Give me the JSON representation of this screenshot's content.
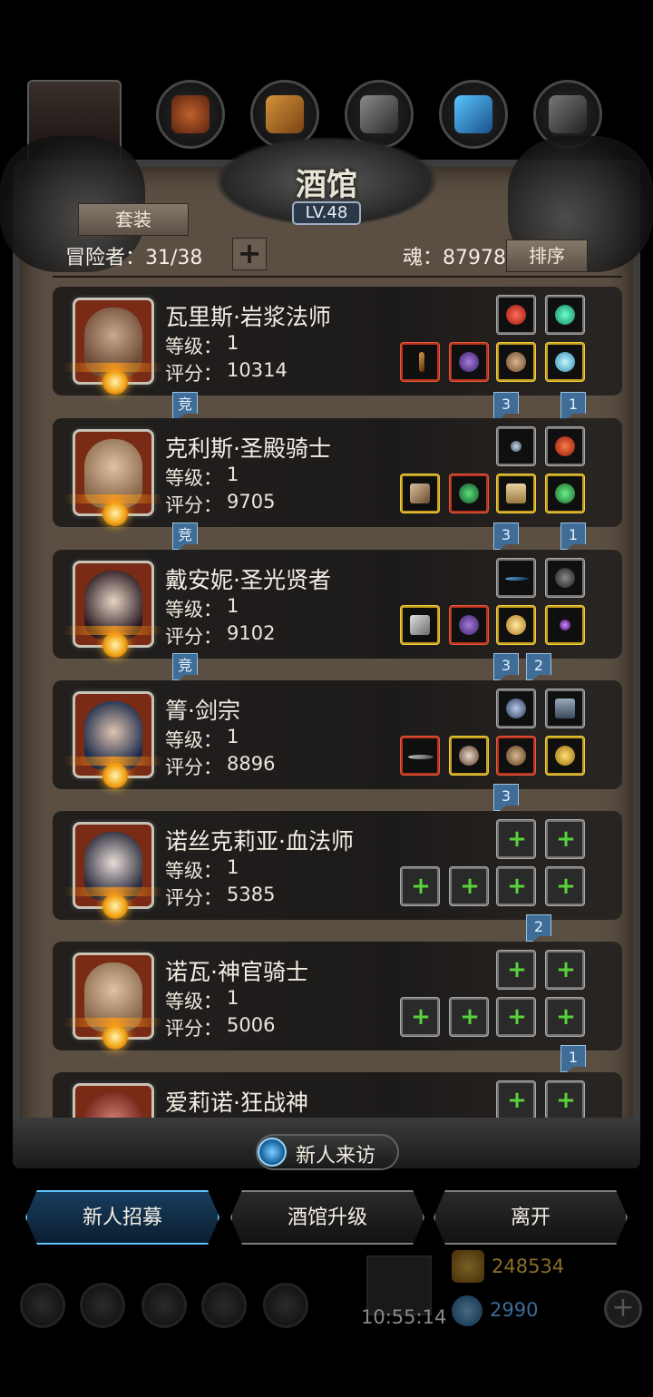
{
  "header": {
    "title": "酒馆",
    "level": "LV.48"
  },
  "controls": {
    "suit_label": "套装",
    "adventurers_label": "冒险者：",
    "adventurers_count": "31/38",
    "add_label": "+",
    "soul_label": "魂：",
    "soul_value": "87978",
    "sort_label": "排序"
  },
  "heroes": [
    {
      "name": "瓦里斯·岩浆法师",
      "level_label": "等级：",
      "level": "1",
      "score_label": "评分：",
      "score": "10314"
    },
    {
      "name": "克利斯·圣殿骑士",
      "level_label": "等级：",
      "level": "1",
      "score_label": "评分：",
      "score": "9705"
    },
    {
      "name": "戴安妮·圣光贤者",
      "level_label": "等级：",
      "level": "1",
      "score_label": "评分：",
      "score": "9102"
    },
    {
      "name": "箐·剑宗",
      "level_label": "等级：",
      "level": "1",
      "score_label": "评分：",
      "score": "8896"
    },
    {
      "name": "诺丝克莉亚·血法师",
      "level_label": "等级：",
      "level": "1",
      "score_label": "评分：",
      "score": "5385"
    },
    {
      "name": "诺瓦·神官骑士",
      "level_label": "等级：",
      "level": "1",
      "score_label": "评分：",
      "score": "5006"
    },
    {
      "name": "爱莉诺·狂战神"
    }
  ],
  "tags": {
    "compete": "竞",
    "t1": "1",
    "t2": "2",
    "t3": "3"
  },
  "bottom": {
    "new_visitor": "新人来访",
    "recruit": "新人招募",
    "upgrade": "酒馆升级",
    "leave": "离开",
    "timer": "10:55:14",
    "gold": "248534",
    "gems": "2990"
  },
  "colors": {
    "accent_blue": "#5ec3ff",
    "frame_brown": "#5b4f43",
    "green_plus": "#59d23a"
  }
}
